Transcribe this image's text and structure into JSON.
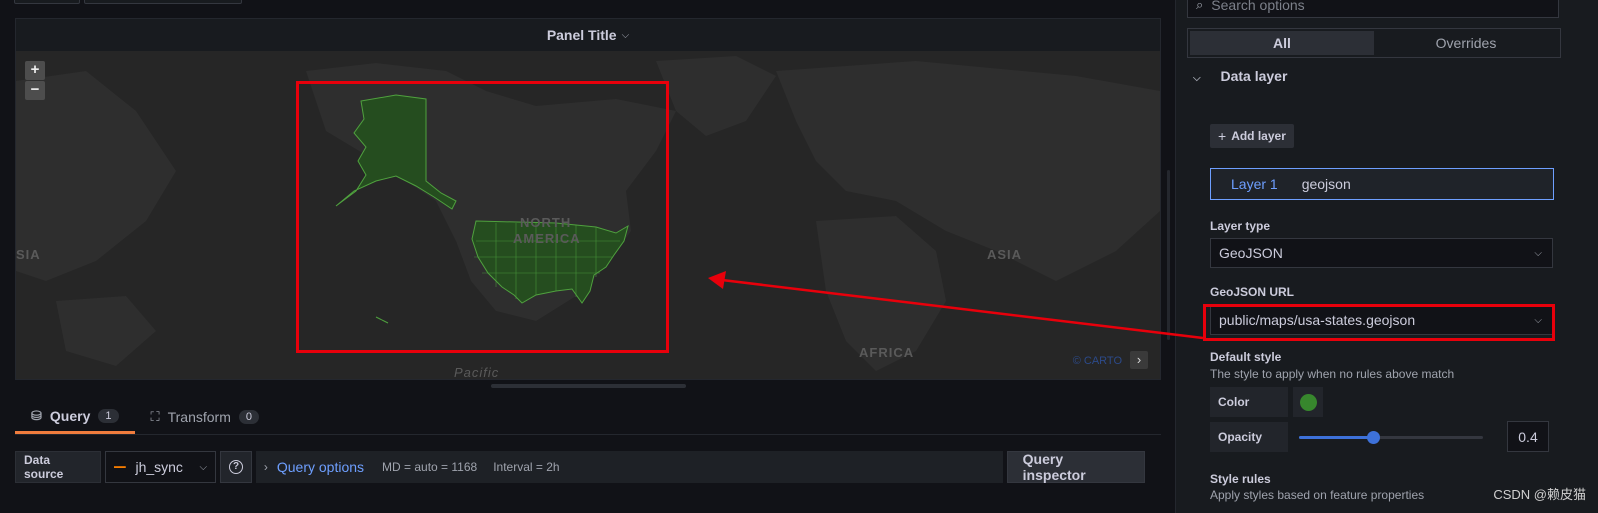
{
  "panel": {
    "title": "Panel Title"
  },
  "map": {
    "zoom_in": "+",
    "zoom_out": "−",
    "attribution": "© CARTO",
    "attribution_toggle": "›",
    "labels": {
      "north_america_1": "NORTH",
      "north_america_2": "AMERICA",
      "asia_left": "SIA",
      "asia_right": "ASIA",
      "africa": "AFRICA",
      "pacific": "Pacific"
    },
    "land_color": "#2b2b2b",
    "highlight_color": "#37872d"
  },
  "query_tabs": [
    {
      "label": "Query",
      "count": "1"
    },
    {
      "label": "Transform",
      "count": "0"
    }
  ],
  "query_row": {
    "datasource_label": "Data source",
    "datasource_name": "jh_sync",
    "help": "?",
    "query_options": "Query options",
    "md": "MD = auto = 1168",
    "interval": "Interval = 2h",
    "inspector": "Query inspector"
  },
  "options": {
    "search_placeholder": "Search options",
    "segments": [
      "All",
      "Overrides"
    ],
    "section_title": "Data layer",
    "add_layer": "Add layer",
    "layer": {
      "name": "Layer 1",
      "type": "geojson"
    },
    "layer_type_label": "Layer type",
    "layer_type_value": "GeoJSON",
    "geojson_url_label": "GeoJSON URL",
    "geojson_url_value": "public/maps/usa-states.geojson",
    "default_style_label": "Default style",
    "default_style_desc": "The style to apply when no rules above match",
    "color_label": "Color",
    "color_value": "#37872d",
    "opacity_label": "Opacity",
    "opacity_value": "0.4",
    "style_rules_label": "Style rules",
    "style_rules_desc": "Apply styles based on feature properties"
  },
  "watermark": "CSDN @赖皮猫"
}
